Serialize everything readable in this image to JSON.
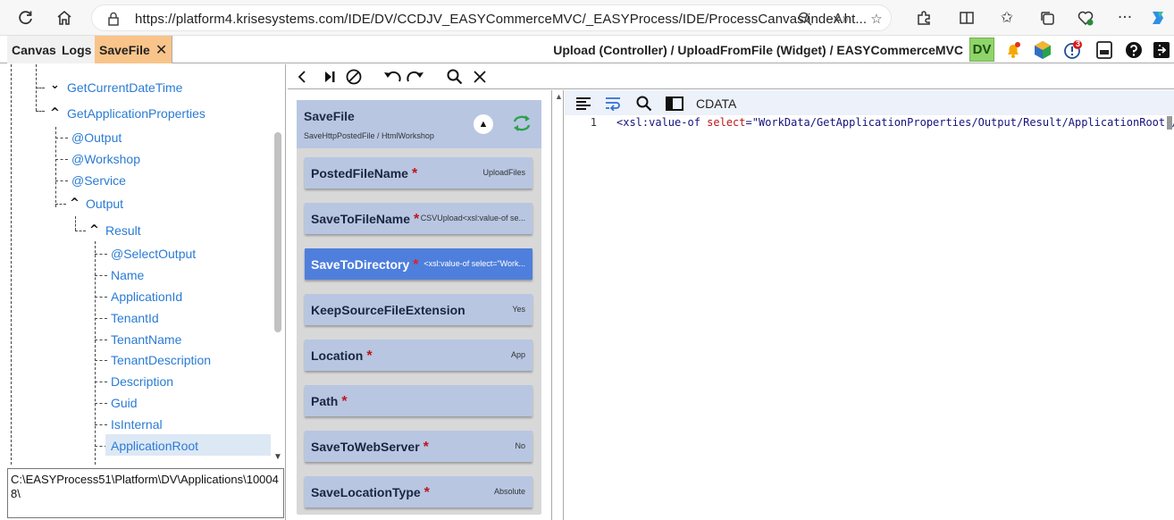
{
  "browser": {
    "url": "https://platform4.krisesystems.com/IDE/DV/CCDJV_EASYCommerceMVC/_EASYProcess/IDE/ProcessCanvas/index.ht...",
    "icons": [
      "refresh-icon",
      "home-icon",
      "lock-icon",
      "zoom-icon",
      "read-aloud-icon",
      "favorite-icon",
      "extensions-icon",
      "split-screen-icon",
      "favorites-icon",
      "collections-icon",
      "browser-essentials-icon",
      "more-icon",
      "copilot-icon"
    ]
  },
  "header": {
    "tabs": [
      {
        "label": "Canvas"
      },
      {
        "label": "Logs"
      },
      {
        "label": "SaveFile",
        "active": true
      }
    ],
    "close_glyph": "✕",
    "breadcrumb": "Upload (Controller) / UploadFromFile (Widget) / EASYCommerceMVC",
    "dv_badge": "DV",
    "notification_count": "3",
    "accent_color": "#f9c48a"
  },
  "tree": {
    "nodes": [
      {
        "label": "GetCurrentDateTime"
      },
      {
        "label": "GetApplicationProperties"
      },
      {
        "label": "@Output"
      },
      {
        "label": "@Workshop"
      },
      {
        "label": "@Service"
      },
      {
        "label": "Output"
      },
      {
        "label": "Result"
      },
      {
        "label": "@SelectOutput"
      },
      {
        "label": "Name"
      },
      {
        "label": "ApplicationId"
      },
      {
        "label": "TenantId"
      },
      {
        "label": "TenantName"
      },
      {
        "label": "TenantDescription"
      },
      {
        "label": "Description"
      },
      {
        "label": "Guid"
      },
      {
        "label": "IsInternal"
      },
      {
        "label": "ApplicationRoot",
        "selected": true
      }
    ],
    "path": "C:\\EASYProcess51\\Platform\\DV\\Applications\\100048\\"
  },
  "widget": {
    "title": "SaveFile",
    "subtitle": "SaveHttpPostedFile / HtmlWorkshop",
    "params": [
      {
        "name": "PostedFileName",
        "required": "*",
        "value": "UploadFiles"
      },
      {
        "name": "SaveToFileName",
        "required": "*",
        "value": "CSVUpload<xsl:value-of se..."
      },
      {
        "name": "SaveToDirectory",
        "required": "*",
        "value": "<xsl:value-of select=\"Work...",
        "active": true
      },
      {
        "name": "KeepSourceFileExtension",
        "required": "",
        "value": "Yes"
      },
      {
        "name": "Location",
        "required": "*",
        "value": "App"
      },
      {
        "name": "Path",
        "required": "*",
        "value": ""
      },
      {
        "name": "SaveToWebServer",
        "required": "*",
        "value": "No"
      },
      {
        "name": "SaveLocationType",
        "required": "*",
        "value": "Absolute"
      }
    ]
  },
  "editor": {
    "mode_label": "CDATA",
    "line_number": "1",
    "code": {
      "open": "<xsl:value-of ",
      "attr": "select",
      "eq": "=",
      "value": "\"WorkData/GetApplicationProperties/Output/Result/ApplicationRoot\"",
      "close": "/>"
    }
  }
}
